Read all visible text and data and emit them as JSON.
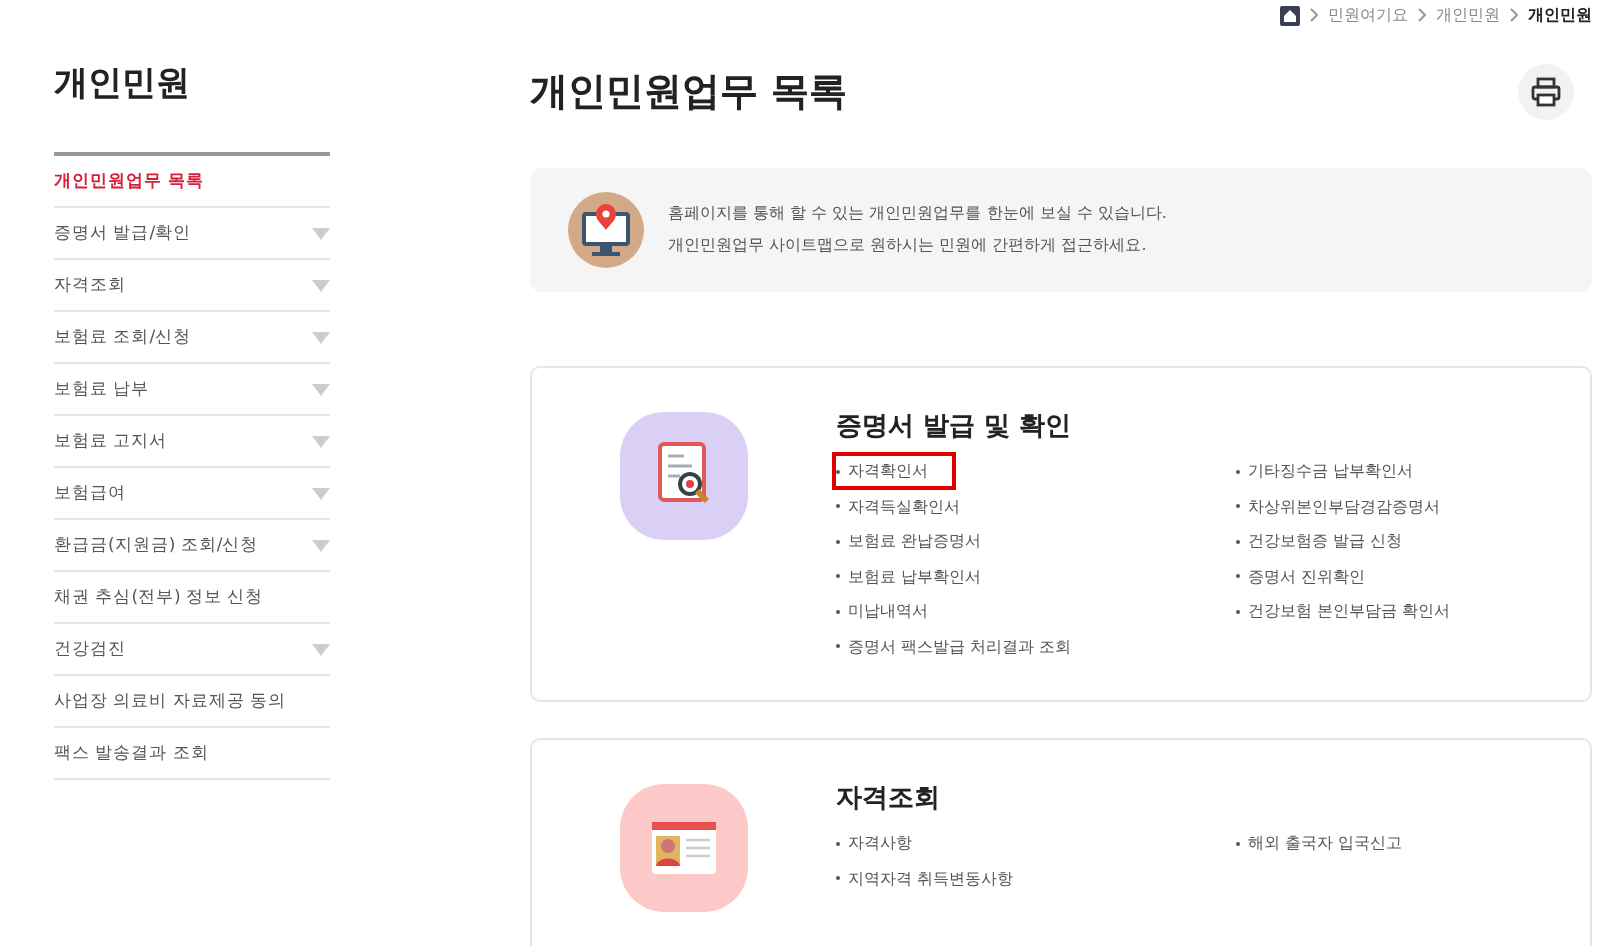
{
  "breadcrumb": [
    "민원여기요",
    "개인민원",
    "개인민원"
  ],
  "sidebar": {
    "title": "개인민원",
    "items": [
      {
        "label": "개인민원업무 목록",
        "selected": true,
        "expandable": false
      },
      {
        "label": "증명서 발급/확인",
        "selected": false,
        "expandable": true
      },
      {
        "label": "자격조회",
        "selected": false,
        "expandable": true
      },
      {
        "label": "보험료 조회/신청",
        "selected": false,
        "expandable": true
      },
      {
        "label": "보험료 납부",
        "selected": false,
        "expandable": true
      },
      {
        "label": "보험료 고지서",
        "selected": false,
        "expandable": true
      },
      {
        "label": "보험급여",
        "selected": false,
        "expandable": true
      },
      {
        "label": "환급금(지원금) 조회/신청",
        "selected": false,
        "expandable": true
      },
      {
        "label": "채권 추심(전부) 정보 신청",
        "selected": false,
        "expandable": false
      },
      {
        "label": "건강검진",
        "selected": false,
        "expandable": true
      },
      {
        "label": "사업장 의료비 자료제공 동의",
        "selected": false,
        "expandable": false
      },
      {
        "label": "팩스 발송결과 조회",
        "selected": false,
        "expandable": false
      }
    ]
  },
  "page_title": "개인민원업무 목록",
  "info": [
    "홈페이지를 통해 할 수 있는 개인민원업무를 한눈에 보실 수 있습니다.",
    "개인민원업무 사이트맵으로 원하시는 민원에 간편하게 접근하세요."
  ],
  "sections": [
    {
      "kind": "certificate",
      "title": "증명서 발급 및 확인",
      "columns": [
        [
          {
            "label": "자격확인서",
            "highlighted": true
          },
          {
            "label": "자격득실확인서",
            "highlighted": false
          },
          {
            "label": "보험료 완납증명서",
            "highlighted": false
          },
          {
            "label": "보험료 납부확인서",
            "highlighted": false
          },
          {
            "label": "미납내역서",
            "highlighted": false
          },
          {
            "label": "증명서 팩스발급 처리결과 조회",
            "highlighted": false
          }
        ],
        [
          {
            "label": "기타징수금 납부확인서",
            "highlighted": false
          },
          {
            "label": "차상위본인부담경감증명서",
            "highlighted": false
          },
          {
            "label": "건강보험증 발급 신청",
            "highlighted": false
          },
          {
            "label": "증명서 진위확인",
            "highlighted": false
          },
          {
            "label": "건강보험 본인부담금 확인서",
            "highlighted": false
          }
        ]
      ]
    },
    {
      "kind": "qualification",
      "title": "자격조회",
      "columns": [
        [
          {
            "label": "자격사항",
            "highlighted": false
          },
          {
            "label": "지역자격 취득변동사항",
            "highlighted": false
          }
        ],
        [
          {
            "label": "해외 출국자 입국신고",
            "highlighted": false
          }
        ]
      ]
    }
  ]
}
